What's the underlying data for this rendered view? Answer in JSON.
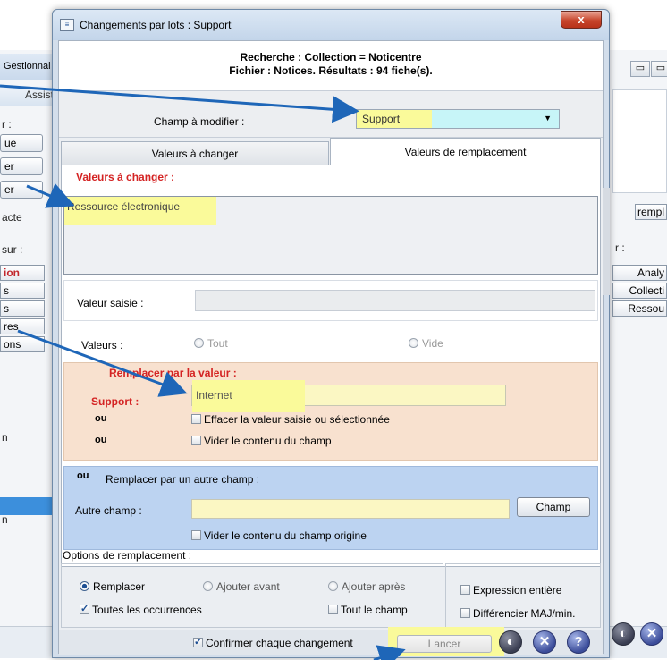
{
  "background": {
    "window_title": "Gestionnai",
    "toolbar_label": "Assist",
    "left_label_r": "r :",
    "left_buttons": [
      "ue",
      "er",
      "er"
    ],
    "left_text_acte": "acte",
    "left_sur": "sur :",
    "left_side_buttons": [
      "ion",
      "s",
      "s",
      "res",
      "ons"
    ],
    "left_n1": "n",
    "left_n2": "n",
    "right_buttons": [
      "Analy",
      "Collecti",
      "Ressou"
    ],
    "right_small_button": "rempl",
    "right_label": "r :"
  },
  "dialog": {
    "title": "Changements par lots : Support",
    "close_label": "x",
    "header_line1": "Recherche : Collection = Noticentre",
    "header_line2": "Fichier : Notices. Résultats : 94 fiche(s).",
    "champ_label": "Champ à modifier :",
    "champ_value": "Support",
    "tabs": [
      "Valeurs à changer",
      "Valeurs de remplacement"
    ],
    "valeurs_title": "Valeurs à changer :",
    "valeurs_items": [
      "Ressource électronique"
    ],
    "valeur_saisie_label": "Valeur saisie :",
    "valeurs_label": "Valeurs :",
    "valeurs_radio": [
      "Tout",
      "Vide"
    ],
    "remplacer_title": "Remplacer par la valeur :",
    "support_label": "Support :",
    "support_value": "Internet",
    "ou": "ou",
    "effacer_label": "Effacer la valeur saisie ou sélectionnée",
    "vider_label": "Vider le contenu du champ",
    "autre_title": "Remplacer par un autre champ :",
    "autre_champ_label": "Autre champ :",
    "champ_button": "Champ",
    "vider_origine_label": "Vider le contenu du champ origine",
    "options_title": "Options de remplacement :",
    "option_remplacer": "Remplacer",
    "option_ajouter_avant": "Ajouter avant",
    "option_ajouter_apres": "Ajouter après",
    "option_toutes": "Toutes les occurrences",
    "option_tout_champ": "Tout le champ",
    "option_expression": "Expression entière",
    "option_maj": "Différencier MAJ/min.",
    "confirmer_label": "Confirmer chaque changement",
    "lancer_label": "Lancer"
  },
  "colors": {
    "highlight": "#fafa9a",
    "red_title": "#d42323",
    "arrow": "#1e66b8",
    "remplacer_bg": "#f8e1cf",
    "autre_bg": "#bcd3f1"
  }
}
